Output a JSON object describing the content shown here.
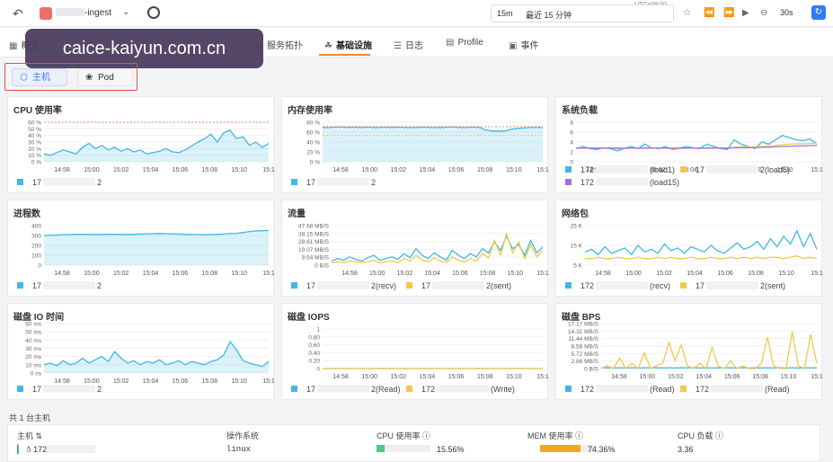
{
  "topbar": {
    "back_icon": "back-arrow-icon",
    "app_name_suffix": "-ingest",
    "time_range_short": "15m",
    "time_range_label": "最近 15 分钟",
    "timezone": "UTC+08:00",
    "refresh_interval": "30s",
    "accent": "#2f7df6"
  },
  "watermark": "caice-kaiyun.com.cn",
  "tabs": [
    {
      "label": "概览",
      "icon": "overview-icon"
    },
    {
      "label": "服务拓扑",
      "icon": "topology-icon"
    },
    {
      "label": "基础设施",
      "icon": "infra-icon",
      "active": true
    },
    {
      "label": "日志",
      "icon": "log-icon"
    },
    {
      "label": "Profile",
      "icon": "profile-icon"
    },
    {
      "label": "事件",
      "icon": "event-icon"
    }
  ],
  "segments": {
    "host": "主机",
    "pod": "Pod"
  },
  "panels": [
    {
      "title": "CPU 使用率",
      "legend": [
        {
          "prefix": "17",
          "suffix": "2",
          "color": "#3fb8e8"
        }
      ]
    },
    {
      "title": "内存使用率",
      "legend": [
        {
          "prefix": "17",
          "suffix": "2",
          "color": "#3fb8e8"
        }
      ]
    },
    {
      "title": "系统负载",
      "legend": [
        {
          "prefix": "172",
          "suffix": "(load1)",
          "color": "#3fb8e8"
        },
        {
          "prefix": "17",
          "suffix": "2(load5)",
          "color": "#f2c94c"
        },
        {
          "prefix": "172",
          "suffix": "(load15)",
          "color": "#a070e0"
        }
      ]
    },
    {
      "title": "进程数",
      "legend": [
        {
          "prefix": "17",
          "suffix": "2",
          "color": "#3fb8e8"
        }
      ]
    },
    {
      "title": "流量",
      "legend": [
        {
          "prefix": "17",
          "suffix": "2(recv)",
          "color": "#3fb8e8"
        },
        {
          "prefix": "17",
          "suffix": "2(sent)",
          "color": "#f2c94c"
        }
      ]
    },
    {
      "title": "网络包",
      "legend": [
        {
          "prefix": "172",
          "suffix": "(recv)",
          "color": "#3fb8e8"
        },
        {
          "prefix": "17",
          "suffix": "2(sent)",
          "color": "#f2c94c"
        }
      ]
    },
    {
      "title": "磁盘 IO 时间",
      "legend": [
        {
          "prefix": "17",
          "suffix": "2",
          "color": "#3fb8e8"
        }
      ]
    },
    {
      "title": "磁盘 IOPS",
      "legend": [
        {
          "prefix": "17",
          "suffix": "2(Read)",
          "color": "#3fb8e8"
        },
        {
          "prefix": "172",
          "suffix": "(Write)",
          "color": "#f2c94c"
        }
      ]
    },
    {
      "title": "磁盘 BPS",
      "legend": [
        {
          "prefix": "172",
          "suffix": "(Read)",
          "color": "#3fb8e8"
        },
        {
          "prefix": "172",
          "suffix": "(Read)",
          "color": "#f2c94c"
        }
      ]
    }
  ],
  "chart_data": [
    {
      "type": "area",
      "title": "CPU 使用率",
      "x": [
        "14:58",
        "15:00",
        "15:02",
        "15:04",
        "15:06",
        "15:08",
        "15:10",
        "15:1"
      ],
      "y_ticks": [
        "60 %",
        "50 %",
        "40 %",
        "30 %",
        "20 %",
        "10 %",
        "0 %"
      ],
      "ylim": [
        0,
        60
      ],
      "series": [
        {
          "values": [
            12,
            10,
            14,
            18,
            15,
            12,
            22,
            28,
            20,
            25,
            18,
            22,
            16,
            20,
            15,
            18,
            12,
            14,
            16,
            20,
            15,
            14,
            18,
            24,
            30,
            35,
            42,
            30,
            44,
            48,
            35,
            38,
            25,
            30,
            22,
            28
          ]
        }
      ]
    },
    {
      "type": "area",
      "title": "内存使用率",
      "x": [
        "14:58",
        "15:00",
        "15:02",
        "15:04",
        "15:06",
        "15:08",
        "15:10",
        "15:1"
      ],
      "y_ticks": [
        "80 %",
        "60 %",
        "40 %",
        "20 %",
        "0 %"
      ],
      "ylim": [
        0,
        90
      ],
      "series": [
        {
          "values": [
            78,
            78,
            79,
            79,
            78,
            79,
            78,
            79,
            78,
            78,
            79,
            78,
            79,
            78,
            78,
            78,
            79,
            78,
            78,
            78,
            79,
            79,
            78,
            78,
            79,
            78,
            72,
            70,
            70,
            70,
            74,
            76,
            77,
            78,
            78,
            78
          ]
        }
      ]
    },
    {
      "type": "line",
      "title": "系统负载",
      "x": [
        "14:58",
        "15:00",
        "15:02",
        "15:04",
        "15:06",
        "15:08",
        "15:10",
        "15:1"
      ],
      "y_ticks": [
        "8",
        "6",
        "4",
        "2",
        "0"
      ],
      "ylim": [
        0,
        9
      ],
      "series": [
        {
          "values": [
            3,
            3.5,
            3,
            2.8,
            3.2,
            3,
            2.5,
            3,
            3.5,
            3,
            4,
            3.2,
            3,
            3.5,
            2.8,
            3,
            3.5,
            3.2,
            3,
            4,
            3.5,
            3,
            2.8,
            5,
            4,
            3.5,
            3,
            4.5,
            4,
            5,
            6,
            5.5,
            5,
            4.8,
            5.2,
            4
          ]
        },
        {
          "values": [
            3.2,
            3.2,
            3.1,
            3.1,
            3.1,
            3.2,
            3,
            3,
            3.1,
            3.1,
            3.2,
            3.2,
            3.1,
            3.1,
            3,
            3,
            3.1,
            3.1,
            3.1,
            3.2,
            3.2,
            3.1,
            3.1,
            3.3,
            3.4,
            3.4,
            3.4,
            3.5,
            3.6,
            3.7,
            3.9,
            4,
            4.1,
            4.1,
            4.2,
            4.2
          ]
        },
        {
          "values": [
            3.1,
            3.1,
            3.1,
            3.1,
            3.1,
            3.1,
            3.1,
            3.1,
            3.1,
            3.1,
            3.1,
            3.1,
            3.1,
            3.1,
            3.1,
            3.1,
            3.1,
            3.1,
            3.1,
            3.1,
            3.1,
            3.1,
            3.1,
            3.2,
            3.2,
            3.2,
            3.2,
            3.3,
            3.3,
            3.4,
            3.5,
            3.5,
            3.6,
            3.6,
            3.7,
            3.7
          ]
        }
      ]
    },
    {
      "type": "area",
      "title": "进程数",
      "x": [
        "14:58",
        "15:00",
        "15:02",
        "15:04",
        "15:06",
        "15:08",
        "15:10",
        "15:1"
      ],
      "y_ticks": [
        "400",
        "300",
        "200",
        "100",
        "0"
      ],
      "ylim": [
        0,
        400
      ],
      "series": [
        {
          "values": [
            300,
            302,
            305,
            308,
            310,
            312,
            312,
            311,
            310,
            312,
            313,
            312,
            311,
            310,
            312,
            315,
            316,
            318,
            320,
            318,
            316,
            315,
            312,
            310,
            310,
            308,
            310,
            312,
            315,
            320,
            322,
            330,
            340,
            345,
            348,
            350
          ]
        }
      ]
    },
    {
      "type": "line",
      "title": "流量",
      "x": [
        "14:58",
        "15:00",
        "15:02",
        "15:04",
        "15:06",
        "15:08",
        "15:10",
        "15:1"
      ],
      "y_ticks": [
        "47.68 MB/S",
        "38.15 MB/S",
        "28.61 MB/S",
        "19.07 MB/S",
        "9.54 MB/S",
        "0 B/S"
      ],
      "ylim": [
        0,
        48
      ],
      "series": [
        {
          "values": [
            5,
            8,
            6,
            10,
            7,
            5,
            9,
            12,
            6,
            8,
            10,
            7,
            14,
            9,
            20,
            12,
            8,
            15,
            10,
            6,
            18,
            12,
            8,
            14,
            10,
            20,
            15,
            28,
            18,
            35,
            20,
            25,
            12,
            30,
            15,
            22
          ]
        },
        {
          "values": [
            3,
            4,
            3,
            5,
            4,
            3,
            4,
            6,
            3,
            4,
            5,
            3,
            8,
            5,
            12,
            6,
            4,
            9,
            5,
            3,
            10,
            6,
            4,
            8,
            5,
            14,
            9,
            30,
            12,
            38,
            15,
            28,
            8,
            25,
            10,
            18
          ]
        }
      ]
    },
    {
      "type": "line",
      "title": "网络包",
      "x": [
        "14:58",
        "15:00",
        "15:02",
        "15:04",
        "15:06",
        "15:08",
        "15:10",
        "15:1"
      ],
      "y_ticks": [
        "25 K",
        "15 K",
        "5 K"
      ],
      "ylim": [
        0,
        30
      ],
      "series": [
        {
          "values": [
            10,
            12,
            8,
            14,
            9,
            11,
            13,
            8,
            15,
            10,
            12,
            9,
            16,
            11,
            13,
            9,
            14,
            12,
            10,
            15,
            11,
            9,
            13,
            17,
            12,
            14,
            18,
            12,
            20,
            14,
            22,
            16,
            26,
            14,
            24,
            12
          ]
        },
        {
          "values": [
            5,
            5,
            6,
            5,
            5,
            6,
            5,
            5,
            6,
            5,
            5,
            6,
            5,
            6,
            5,
            5,
            6,
            5,
            5,
            6,
            5,
            5,
            6,
            5,
            6,
            5,
            6,
            5,
            6,
            6,
            5,
            6,
            7,
            5,
            6,
            5
          ]
        }
      ]
    },
    {
      "type": "area",
      "title": "磁盘 IO 时间",
      "x": [
        "14:58",
        "15:00",
        "15:02",
        "15:04",
        "15:06",
        "15:08",
        "15:10",
        "15:1"
      ],
      "y_ticks": [
        "60 ms",
        "50 ms",
        "40 ms",
        "30 ms",
        "20 ms",
        "10 ms",
        "0 ns"
      ],
      "ylim": [
        0,
        60
      ],
      "series": [
        {
          "values": [
            10,
            12,
            9,
            15,
            10,
            12,
            18,
            12,
            16,
            20,
            14,
            26,
            18,
            12,
            15,
            10,
            14,
            12,
            16,
            10,
            12,
            15,
            10,
            14,
            12,
            10,
            14,
            16,
            22,
            38,
            28,
            15,
            12,
            10,
            8,
            14
          ]
        }
      ]
    },
    {
      "type": "line",
      "title": "磁盘 IOPS",
      "x": [
        "14:58",
        "15:00",
        "15:02",
        "15:04",
        "15:06",
        "15:08",
        "15:10",
        "15:1"
      ],
      "y_ticks": [
        "1",
        "0.80",
        "0.60",
        "0.40",
        "0.20",
        "0"
      ],
      "ylim": [
        0,
        1
      ],
      "series": [
        {
          "values": [
            0,
            0,
            0,
            0,
            0,
            0,
            0,
            0,
            0,
            0,
            0,
            0,
            0,
            0,
            0,
            0,
            0,
            0,
            0,
            0,
            0,
            0,
            0,
            0,
            0,
            0,
            0,
            0,
            0,
            0,
            0,
            0,
            0,
            0,
            0,
            0
          ]
        },
        {
          "values": [
            0,
            0,
            0,
            0,
            0,
            0,
            0,
            0,
            0,
            0,
            0,
            0,
            0,
            0,
            0,
            0,
            0,
            0,
            0,
            0,
            0,
            0,
            0,
            0,
            0,
            0,
            0,
            0,
            0,
            0,
            0,
            0,
            0,
            0,
            0,
            0
          ]
        }
      ]
    },
    {
      "type": "line",
      "title": "磁盘 BPS",
      "x": [
        "14:58",
        "15:00",
        "15:02",
        "15:04",
        "15:06",
        "15:08",
        "15:10",
        "15:1"
      ],
      "y_ticks": [
        "17.17 MB/S",
        "14.31 MB/S",
        "11.44 MB/S",
        "8.58 MB/S",
        "5.72 MB/S",
        "2.86 MB/S",
        "0 B/S"
      ],
      "ylim": [
        0,
        17.17
      ],
      "series": [
        {
          "values": [
            0.2,
            0.3,
            0.2,
            0.3,
            0.2,
            0.3,
            0.2,
            0.3,
            0.2,
            0.3,
            0.2,
            0.3,
            0.2,
            0.3,
            0.2,
            0.3,
            0.2,
            0.3,
            0.2,
            0.3,
            0.2,
            0.3,
            0.2,
            0.3,
            0.2,
            0.3,
            0.2,
            0.3,
            0.2,
            0.3,
            0.2,
            0.3,
            0.2,
            0.3,
            0.2,
            0.3
          ]
        },
        {
          "values": [
            0,
            1,
            0,
            4,
            0,
            2,
            0,
            6,
            0,
            1,
            2,
            10,
            3,
            9,
            1,
            0,
            2,
            0,
            8,
            1,
            0,
            3,
            0,
            1,
            0,
            0,
            2,
            12,
            1,
            0,
            0,
            14,
            1,
            0,
            13,
            2
          ]
        }
      ]
    }
  ],
  "footer_count": "共 1 台主机",
  "table": {
    "headers": [
      "主机",
      "操作系统",
      "CPU 使用率",
      "MEM 使用率",
      "CPU 负载"
    ],
    "row": {
      "host_prefix": "172",
      "os": "linux",
      "cpu": "15.56%",
      "cpu_value": 15.56,
      "mem": "74.36%",
      "mem_value": 74.36,
      "load": "3.36"
    }
  }
}
